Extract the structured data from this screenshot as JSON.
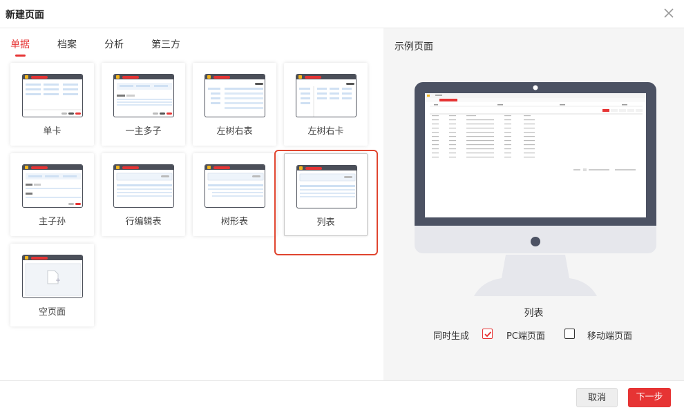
{
  "dialog": {
    "title": "新建页面"
  },
  "tabs": [
    {
      "label": "单据",
      "active": true
    },
    {
      "label": "档案",
      "active": false
    },
    {
      "label": "分析",
      "active": false
    },
    {
      "label": "第三方",
      "active": false
    }
  ],
  "templates": [
    {
      "label": "单卡",
      "icon": "single-card-template-icon"
    },
    {
      "label": "一主多子",
      "icon": "master-multi-detail-template-icon"
    },
    {
      "label": "左树右表",
      "icon": "left-tree-right-table-template-icon"
    },
    {
      "label": "左树右卡",
      "icon": "left-tree-right-card-template-icon"
    },
    {
      "label": "主子孙",
      "icon": "master-child-grandchild-template-icon"
    },
    {
      "label": "行编辑表",
      "icon": "row-edit-table-template-icon"
    },
    {
      "label": "树形表",
      "icon": "tree-table-template-icon"
    },
    {
      "label": "列表",
      "icon": "list-template-icon",
      "selected": true
    },
    {
      "label": "空页面",
      "icon": "blank-page-template-icon"
    }
  ],
  "preview": {
    "title": "示例页面",
    "template_name": "列表",
    "generate_label": "同时生成",
    "pc_label": "PC端页面",
    "pc_checked": true,
    "mobile_label": "移动端页面",
    "mobile_checked": false
  },
  "footer": {
    "cancel_label": "取消",
    "next_label": "下一步"
  },
  "colors": {
    "accent": "#e63434",
    "frame": "#4b4f59"
  }
}
